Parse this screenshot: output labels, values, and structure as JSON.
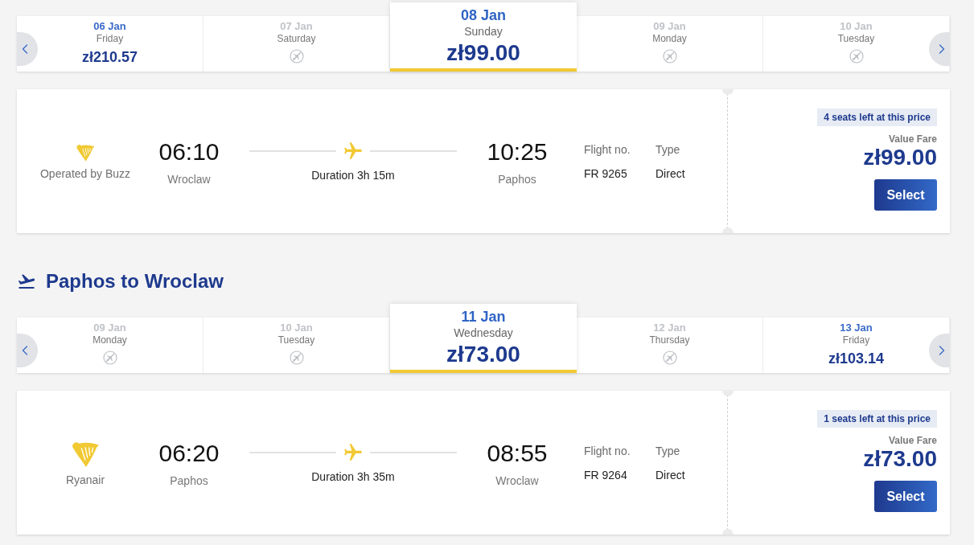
{
  "outbound": {
    "date_carousel": {
      "days": [
        {
          "date": "06 Jan",
          "weekday": "Friday",
          "price": "zł210.57",
          "disabled": false,
          "selected": false
        },
        {
          "date": "07 Jan",
          "weekday": "Saturday",
          "disabled": true,
          "selected": false
        },
        {
          "date": "08 Jan",
          "weekday": "Sunday",
          "price": "zł99.00",
          "disabled": false,
          "selected": true
        },
        {
          "date": "09 Jan",
          "weekday": "Monday",
          "disabled": true,
          "selected": false
        },
        {
          "date": "10 Jan",
          "weekday": "Tuesday",
          "disabled": true,
          "selected": false
        }
      ]
    },
    "flights": [
      {
        "airline": "Operated by Buzz",
        "departure": {
          "time": "06:10",
          "city": "Wroclaw"
        },
        "duration": "Duration 3h 15m",
        "arrival": {
          "time": "10:25",
          "city": "Paphos"
        },
        "details": [
          {
            "label": "Flight no.",
            "value": "FR 9265"
          },
          {
            "label": "Type",
            "value": "Direct"
          }
        ],
        "seats_badge": "4 seats left at this price",
        "fare": "Value Fare",
        "price": "zł99.00",
        "button": "Select"
      }
    ]
  },
  "return": {
    "heading": "Paphos to Wroclaw",
    "date_carousel": {
      "days": [
        {
          "date": "09 Jan",
          "weekday": "Monday",
          "disabled": true,
          "selected": false
        },
        {
          "date": "10 Jan",
          "weekday": "Tuesday",
          "disabled": true,
          "selected": false
        },
        {
          "date": "11 Jan",
          "weekday": "Wednesday",
          "price": "zł73.00",
          "disabled": false,
          "selected": true
        },
        {
          "date": "12 Jan",
          "weekday": "Thursday",
          "disabled": true,
          "selected": false
        },
        {
          "date": "13 Jan",
          "weekday": "Friday",
          "price": "zł103.14",
          "disabled": false,
          "selected": false
        }
      ]
    },
    "flights": [
      {
        "airline": "Ryanair",
        "departure": {
          "time": "06:20",
          "city": "Paphos"
        },
        "duration": "Duration 3h 35m",
        "arrival": {
          "time": "08:55",
          "city": "Wroclaw"
        },
        "details": [
          {
            "label": "Flight no.",
            "value": "FR 9264"
          },
          {
            "label": "Type",
            "value": "Direct"
          }
        ],
        "seats_badge": "1 seats left at this price",
        "fare": "Value Fare",
        "price": "zł73.00",
        "button": "Select"
      }
    ]
  }
}
